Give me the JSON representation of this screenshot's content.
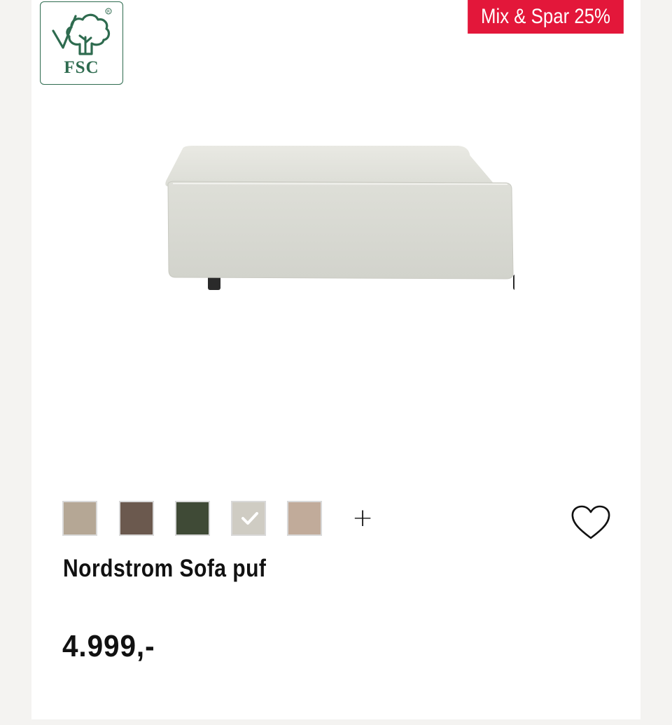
{
  "certification": {
    "label": "FSC",
    "icon": "fsc-tree-checkmark-icon",
    "color": "#2e6b4f"
  },
  "promo_badge": {
    "text": "Mix & Spar 25%",
    "color": "#e3173a"
  },
  "product": {
    "name": "Nordstrom Sofa puf",
    "price": "4.999,-",
    "image_icon": "sofa-pouf-image"
  },
  "swatches": [
    {
      "color": "#b5a795",
      "selected": false
    },
    {
      "color": "#6b594e",
      "selected": false
    },
    {
      "color": "#3f4a36",
      "selected": false
    },
    {
      "color": "#cfccc3",
      "selected": true
    },
    {
      "color": "#c1ab9a",
      "selected": false
    }
  ],
  "more_colors_label": "+",
  "wishlist_icon": "heart-icon"
}
